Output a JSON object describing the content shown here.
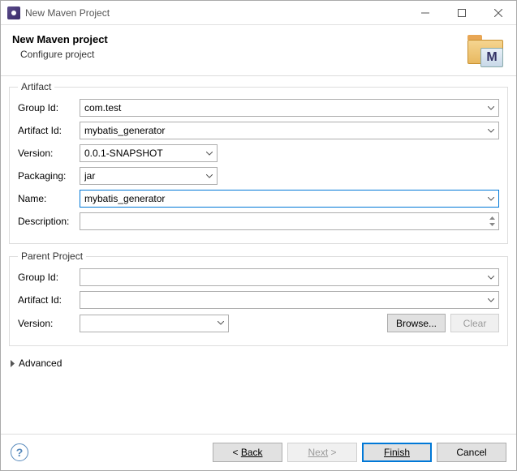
{
  "window": {
    "title": "New Maven Project"
  },
  "header": {
    "title": "New Maven project",
    "subtitle": "Configure project"
  },
  "artifact": {
    "legend": "Artifact",
    "group_id_label": "Group Id:",
    "group_id": "com.test",
    "artifact_id_label": "Artifact Id:",
    "artifact_id": "mybatis_generator",
    "version_label": "Version:",
    "version": "0.0.1-SNAPSHOT",
    "packaging_label": "Packaging:",
    "packaging": "jar",
    "name_label": "Name:",
    "name": "mybatis_generator",
    "description_label": "Description:",
    "description": ""
  },
  "parent": {
    "legend": "Parent Project",
    "group_id_label": "Group Id:",
    "group_id": "",
    "artifact_id_label": "Artifact Id:",
    "artifact_id": "",
    "version_label": "Version:",
    "version": "",
    "browse_label": "Browse...",
    "clear_label": "Clear"
  },
  "advanced_label": "Advanced",
  "footer": {
    "back": "Back",
    "next": "Next",
    "finish": "Finish",
    "cancel": "Cancel"
  }
}
